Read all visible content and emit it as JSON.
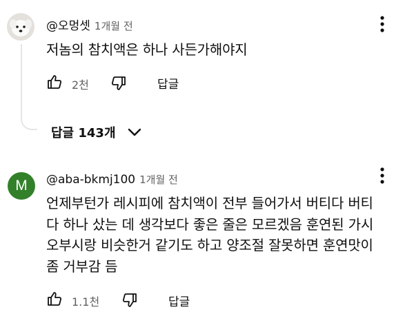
{
  "comments": [
    {
      "handle": "@오멍셋",
      "time": "1개월 전",
      "text": "저놈의 참치액은 하나 사든가해야지",
      "likes": "2천",
      "reply_label": "답글",
      "replies_label": "답글 143개"
    },
    {
      "handle": "@aba-bkmj100",
      "time": "1개월 전",
      "avatar_letter": "M",
      "avatar_color": "#33802b",
      "text_lines": [
        "언제부턴가 레시피에 참치액이 전부 들어가서 버티다 버티",
        "다 하나 샀는 데 생각보다 좋은 줄은 모르겠음 훈연된 가시",
        "오부시랑 비슷한거 같기도 하고 양조절 잘못하면 훈연맛이",
        "좀 거부감 듬"
      ],
      "likes": "1.1천",
      "reply_label": "답글"
    }
  ]
}
